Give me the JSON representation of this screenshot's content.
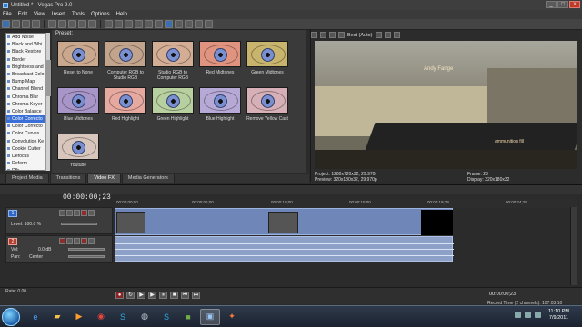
{
  "window": {
    "title": "Untitled * - Vegas Pro 9.0",
    "buttons": [
      "_",
      "□",
      "×"
    ]
  },
  "menu": [
    "File",
    "Edit",
    "View",
    "Insert",
    "Tools",
    "Options",
    "Help"
  ],
  "effects_list": {
    "items": [
      "Add Noise",
      "Black and Whi",
      "Black Restore",
      "Border",
      "Brightness and",
      "Broadcast Colo",
      "Bump Map",
      "Channel Blend",
      "Chroma Blur",
      "Chroma Keyer",
      "Color Balance",
      "Color Correcto",
      "Color Correcto",
      "Color Curves",
      "Convolution Ke",
      "Cookie Cutter",
      "Defocus",
      "Deform",
      "Dfb"
    ],
    "selected_index": 11
  },
  "preset_panel": {
    "label": "Preset:",
    "presets": [
      {
        "name": "Reset to None",
        "tint": "#c9a88e"
      },
      {
        "name": "Computer RGB to Studio RGB",
        "tint": "#c2a38c"
      },
      {
        "name": "Studio RGB to Computer RGB",
        "tint": "#d3ad94"
      },
      {
        "name": "Red Midtones",
        "tint": "#e0937e"
      },
      {
        "name": "Green Midtones",
        "tint": "#c8b46c"
      },
      {
        "name": "Blue Midtones",
        "tint": "#a996c8"
      },
      {
        "name": "Red Highlight",
        "tint": "#e6a9a0"
      },
      {
        "name": "Green Highlight",
        "tint": "#b8cfa0"
      },
      {
        "name": "Blue Highlight",
        "tint": "#b7a9d6"
      },
      {
        "name": "Remove Yellow Cast",
        "tint": "#d6b0b6"
      },
      {
        "name": "Youtube",
        "tint": "#d8c6bc"
      }
    ]
  },
  "tabs": [
    "Project Media",
    "Transitions",
    "Video FX",
    "Media Generators"
  ],
  "active_tab": 2,
  "preview": {
    "quality": "Best (Auto)",
    "project": "Project:  1280x720x32, 29.970i",
    "preview_res": "Preview:  320x180x32, 29.970p",
    "frame": "Frame:       23",
    "display": "Display:     320x180x32",
    "hud_texts": [
      "Andy Fange",
      "ammunition fill"
    ]
  },
  "timeline": {
    "timecode": "00:00:00;23",
    "ruler": [
      "00:00:00;00",
      "00:00:05;00",
      "00:00:10;00",
      "00:00:15;00",
      "00:00:19;29",
      "00:00:24;29"
    ],
    "marker": "00:00:19;29",
    "video_track": {
      "num": "1",
      "level": "Level: 100.0 %"
    },
    "audio_track": {
      "num": "2",
      "vol": "Vol:",
      "vol_value": "0.0 dB",
      "pan": "Pan:",
      "pan_value": "Center"
    }
  },
  "transport": {
    "rate": "Rate: 0.00",
    "buttons": [
      "●",
      "↻",
      "▶",
      "▶",
      "⏸",
      "■",
      "⏮",
      "⏭"
    ],
    "timecode": "00:00:00;23",
    "record_time": "Record Time (2 channels): 107:03:10"
  },
  "taskbar": {
    "time": "11:10 PM",
    "date": "7/9/2011",
    "apps": [
      "ie",
      "folder",
      "media",
      "chrome",
      "skype",
      "steam",
      "skype2",
      "minecraft",
      "vegas",
      "paint"
    ]
  }
}
